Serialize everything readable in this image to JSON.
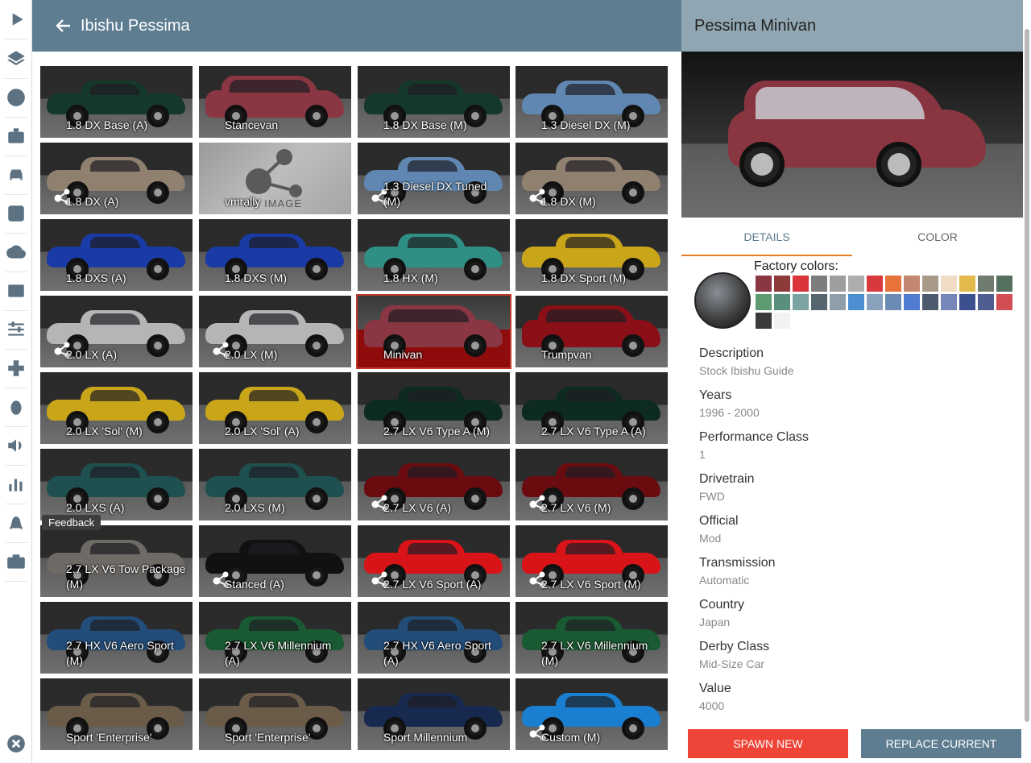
{
  "left_header": {
    "title": "Ibishu Pessima"
  },
  "feedback": "Feedback",
  "tiles": [
    {
      "label": "1.8 DX Base (A)",
      "color": "#14382a",
      "mod": false
    },
    {
      "label": "Stancevan",
      "color": "#8b3743",
      "mod": false,
      "van": true
    },
    {
      "label": "1.8 DX Base (M)",
      "color": "#14382a",
      "mod": false
    },
    {
      "label": "1.3 Diesel DX (M)",
      "color": "#5f87b1",
      "mod": false
    },
    {
      "label": "1.8 DX (A)",
      "color": "#8f8070",
      "mod": true
    },
    {
      "label": "vmrally",
      "noimage": true,
      "noimage_text": "NO IMAGE",
      "mod": false
    },
    {
      "label": "1.3 Diesel DX Tuned (M)",
      "color": "#5f87b1",
      "mod": true
    },
    {
      "label": "1.8 DX (M)",
      "color": "#8f8070",
      "mod": true
    },
    {
      "label": "1.8 DXS (A)",
      "color": "#1a3aa6",
      "mod": false
    },
    {
      "label": "1.8 DXS (M)",
      "color": "#1a3aa6",
      "mod": false
    },
    {
      "label": "1.8 HX (M)",
      "color": "#2f8f85",
      "mod": false
    },
    {
      "label": "1.8 DX Sport (M)",
      "color": "#c9a51a",
      "mod": false
    },
    {
      "label": "2.0 LX (A)",
      "color": "#b5b5b5",
      "mod": true
    },
    {
      "label": "2.0 LX (M)",
      "color": "#b5b5b5",
      "mod": true
    },
    {
      "label": "Minivan",
      "selected": true,
      "color": "#8b3743",
      "mod": false,
      "van": true
    },
    {
      "label": "Trumpvan",
      "color": "#8a0f17",
      "mod": false,
      "van": true
    },
    {
      "label": "2.0 LX 'Sol' (M)",
      "color": "#c9a51a",
      "mod": false
    },
    {
      "label": "2.0 LX 'Sol' (A)",
      "color": "#c9a51a",
      "mod": false
    },
    {
      "label": "2.7 LX V6 Type A (M)",
      "color": "#0e2b22",
      "mod": false
    },
    {
      "label": "2.7 LX V6 Type A (A)",
      "color": "#0e2b22",
      "mod": false
    },
    {
      "label": "2.0 LXS (A)",
      "color": "#1f5050",
      "mod": false
    },
    {
      "label": "2.0 LXS (M)",
      "color": "#1f5050",
      "mod": false
    },
    {
      "label": "2.7 LX V6 (A)",
      "color": "#6a0b10",
      "mod": true
    },
    {
      "label": "2.7 LX V6 (M)",
      "color": "#6a0b10",
      "mod": true
    },
    {
      "label": "2.7 LX V6 Tow Package (M)",
      "color": "#6e6a66",
      "mod": false
    },
    {
      "label": "Stanced (A)",
      "color": "#111111",
      "mod": true
    },
    {
      "label": "2.7 LX V6 Sport (A)",
      "color": "#d81418",
      "mod": true
    },
    {
      "label": "2.7 LX V6 Sport (M)",
      "color": "#d81418",
      "mod": true
    },
    {
      "label": "2.7 HX V6 Aero Sport (M)",
      "color": "#234d79",
      "mod": false
    },
    {
      "label": "2.7 LX V6 Millennium (A)",
      "color": "#1a5a32",
      "mod": false
    },
    {
      "label": "2.7 HX V6 Aero Sport (A)",
      "color": "#234d79",
      "mod": false
    },
    {
      "label": "2.7 LX V6 Millennium (M)",
      "color": "#1a5a32",
      "mod": false
    },
    {
      "label": "Sport 'Enterprise'",
      "color": "#6a5c49",
      "mod": false
    },
    {
      "label": "Sport 'Enterprise'",
      "color": "#6a5c49",
      "mod": false
    },
    {
      "label": "Sport Millennium",
      "color": "#18294f",
      "mod": false
    },
    {
      "label": "Custom (M)",
      "color": "#1a7fd1",
      "mod": true
    }
  ],
  "right": {
    "title": "Pessima Minivan",
    "tabs": [
      "DETAILS",
      "COLOR"
    ],
    "factory_colors_label": "Factory colors:",
    "swatches": [
      "#8b3743",
      "#8c3a3a",
      "#d9353b",
      "#7d7d7d",
      "#9e9e9e",
      "#aeaeae",
      "#d8393c",
      "#e8733a",
      "#c3876f",
      "#a89a88",
      "#f1dcc7",
      "#e2b94a",
      "#6f7b6f",
      "#55705e",
      "#5e9a72",
      "#5a8f7b",
      "#7aa3a2",
      "#55666e",
      "#8e9faa",
      "#4b8fd1",
      "#8aa1bd",
      "#6b8ab4",
      "#4f7bd0",
      "#4d596d",
      "#7686b8",
      "#3c4f8f",
      "#4f5e8f",
      "#d14e55",
      "#3a3a3a",
      "#f2f2f2"
    ],
    "details": [
      {
        "label": "Description",
        "value": "Stock Ibishu Guide"
      },
      {
        "label": "Years",
        "value": "1996 - 2000"
      },
      {
        "label": "Performance Class",
        "value": "1"
      },
      {
        "label": "Drivetrain",
        "value": "FWD"
      },
      {
        "label": "Official",
        "value": "Mod"
      },
      {
        "label": "Transmission",
        "value": "Automatic"
      },
      {
        "label": "Country",
        "value": "Japan"
      },
      {
        "label": "Derby Class",
        "value": "Mid-Size Car"
      },
      {
        "label": "Value",
        "value": "4000"
      }
    ],
    "spawn_label": "SPAWN NEW",
    "replace_label": "REPLACE CURRENT"
  },
  "sidebar_icons": [
    "play-icon",
    "layers-icon",
    "help-icon",
    "briefcase-icon",
    "car-icon",
    "settings-icon",
    "cloud-icon",
    "dashboard-icon",
    "sliders-icon",
    "gamepad-icon",
    "bug-icon",
    "volume-icon",
    "chart-icon",
    "route-icon",
    "camera-icon",
    "close-icon"
  ]
}
